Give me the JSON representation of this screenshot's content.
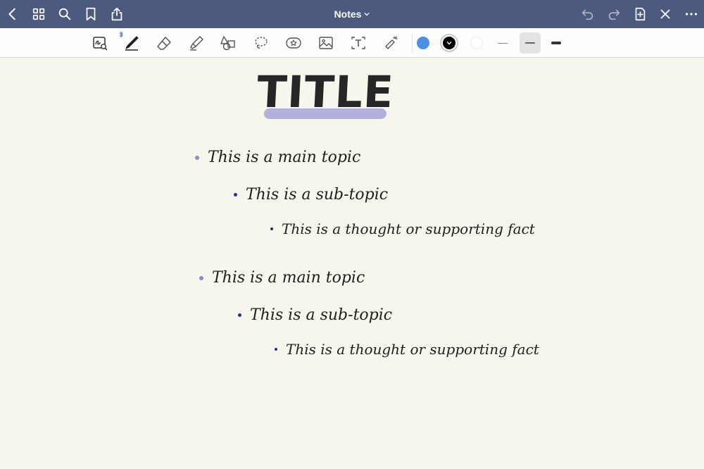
{
  "navbar": {
    "title": "Notes",
    "icons": [
      "back-chevron-icon",
      "grid-icon",
      "search-icon",
      "bookmark-icon",
      "share-icon",
      "undo-icon",
      "redo-icon",
      "add-page-icon",
      "close-icon",
      "more-icon"
    ]
  },
  "toolbar": {
    "tools": [
      "lasso-zoom-icon",
      "pen-icon",
      "eraser-icon",
      "highlighter-icon",
      "shapes-icon",
      "lasso-icon",
      "sticker-icon",
      "image-icon",
      "text-icon",
      "laser-pointer-icon"
    ],
    "colors": {
      "blue": "#4a90e2",
      "black": "#000000",
      "white": "#ffffff"
    },
    "selected_color": "black"
  },
  "note": {
    "title": "TITLE",
    "highlight_color": "#b3b1dc",
    "sections": [
      {
        "main": "This is a main topic",
        "sub": "This is a sub-topic",
        "fact": "This is a thought or supporting fact"
      },
      {
        "main": "This is a main topic",
        "sub": "This is a sub-topic",
        "fact": "This is a thought or supporting fact"
      }
    ]
  }
}
